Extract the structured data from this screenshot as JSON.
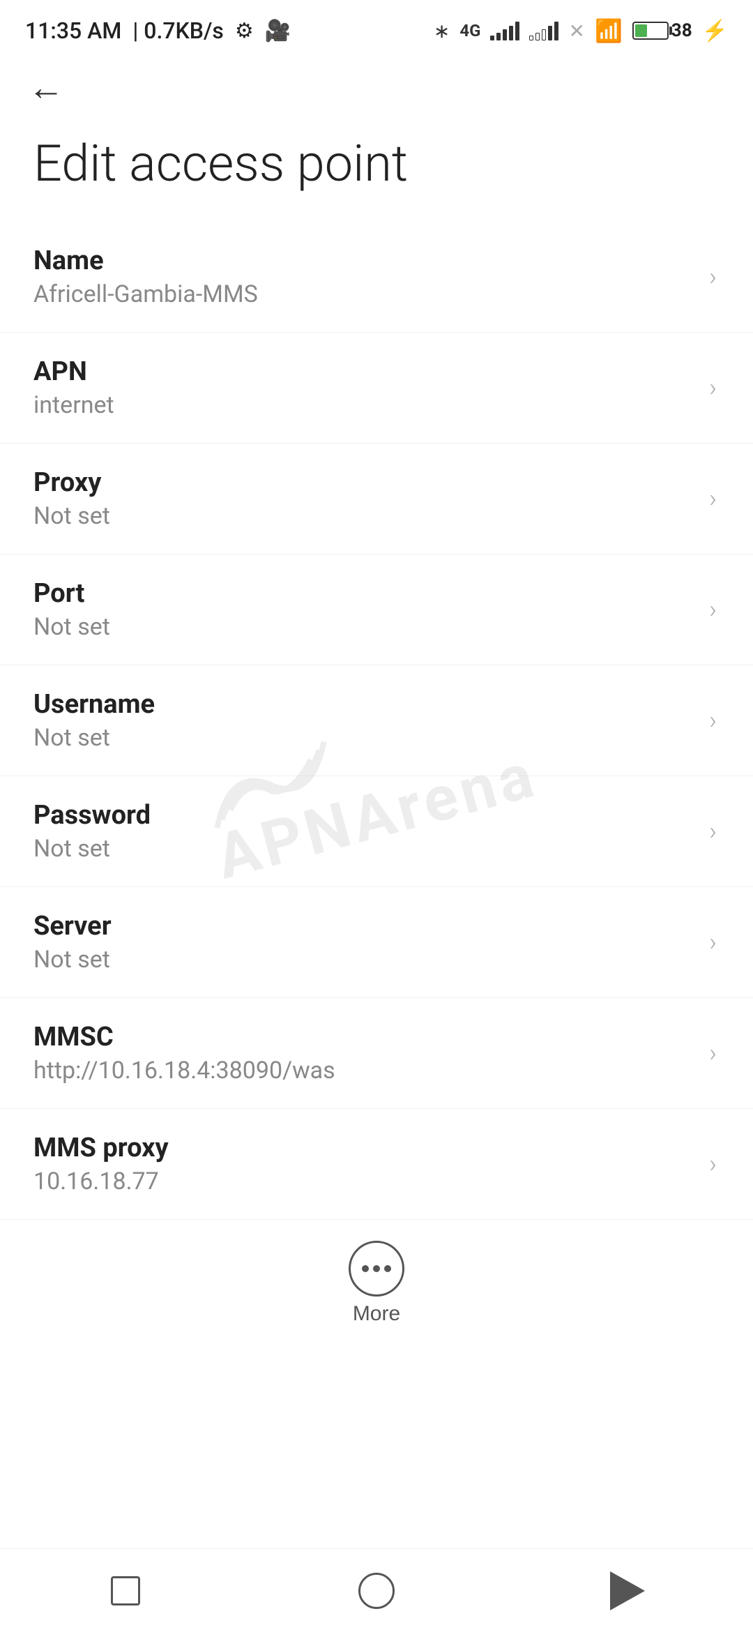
{
  "statusBar": {
    "time": "11:35 AM",
    "speed": "0.7KB/s"
  },
  "nav": {
    "backLabel": "←"
  },
  "page": {
    "title": "Edit access point"
  },
  "settings": [
    {
      "label": "Name",
      "value": "Africell-Gambia-MMS"
    },
    {
      "label": "APN",
      "value": "internet"
    },
    {
      "label": "Proxy",
      "value": "Not set"
    },
    {
      "label": "Port",
      "value": "Not set"
    },
    {
      "label": "Username",
      "value": "Not set"
    },
    {
      "label": "Password",
      "value": "Not set"
    },
    {
      "label": "Server",
      "value": "Not set"
    },
    {
      "label": "MMSC",
      "value": "http://10.16.18.4:38090/was"
    },
    {
      "label": "MMS proxy",
      "value": "10.16.18.77"
    }
  ],
  "more": {
    "label": "More"
  },
  "watermark": {
    "text": "APNArena"
  }
}
